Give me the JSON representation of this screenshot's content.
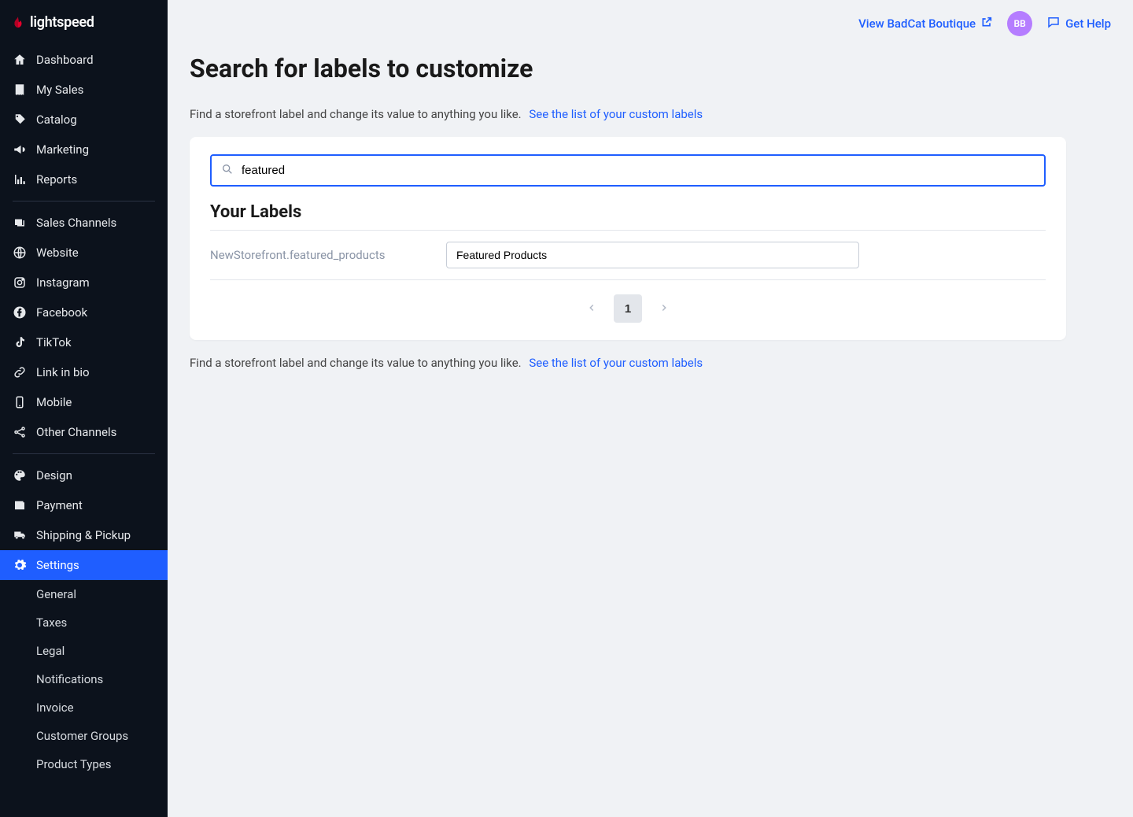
{
  "brand": {
    "name": "lightspeed"
  },
  "topbar": {
    "view_store": "View BadCat Boutique",
    "avatar": "BB",
    "get_help": "Get Help"
  },
  "sidebar": {
    "items": [
      {
        "icon": "home",
        "label": "Dashboard"
      },
      {
        "icon": "receipt",
        "label": "My Sales"
      },
      {
        "icon": "tag",
        "label": "Catalog"
      },
      {
        "icon": "megaphone",
        "label": "Marketing"
      },
      {
        "icon": "chart",
        "label": "Reports"
      }
    ],
    "channels": [
      {
        "icon": "layers",
        "label": "Sales Channels"
      },
      {
        "icon": "globe",
        "label": "Website"
      },
      {
        "icon": "instagram",
        "label": "Instagram"
      },
      {
        "icon": "facebook",
        "label": "Facebook"
      },
      {
        "icon": "tiktok",
        "label": "TikTok"
      },
      {
        "icon": "link",
        "label": "Link in bio"
      },
      {
        "icon": "mobile",
        "label": "Mobile"
      },
      {
        "icon": "share",
        "label": "Other Channels"
      }
    ],
    "setup": [
      {
        "icon": "palette",
        "label": "Design"
      },
      {
        "icon": "wallet",
        "label": "Payment"
      },
      {
        "icon": "truck",
        "label": "Shipping & Pickup"
      },
      {
        "icon": "gear",
        "label": "Settings",
        "active": true
      }
    ],
    "subnav": [
      "General",
      "Taxes",
      "Legal",
      "Notifications",
      "Invoice",
      "Customer Groups",
      "Product Types"
    ]
  },
  "page": {
    "title": "Search for labels to customize",
    "hint": "Find a storefront label and change its value to anything you like.",
    "link": "See the list of your custom labels",
    "search_value": "featured",
    "section_title": "Your Labels",
    "labels": [
      {
        "key": "NewStorefront.featured_products",
        "value": "Featured Products"
      }
    ],
    "pagination": {
      "current": "1"
    }
  }
}
